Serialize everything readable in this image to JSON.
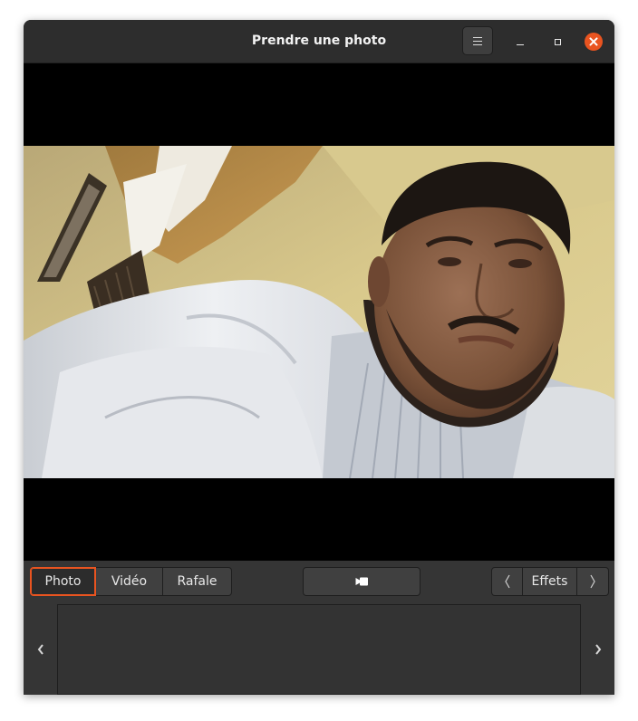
{
  "window": {
    "title": "Prendre une photo"
  },
  "header": {
    "menu_icon": "hamburger-menu-icon",
    "controls": [
      "minimize-icon",
      "maximize-icon",
      "close-icon"
    ]
  },
  "viewport": {
    "content": "camera-feed-image"
  },
  "modes": {
    "photo": "Photo",
    "video": "Vidéo",
    "burst": "Rafale",
    "active": "Photo"
  },
  "shutter": {
    "icon": "video-camera-icon"
  },
  "effects": {
    "label": "Effets",
    "prev_icon": "chevron-left-icon",
    "next_icon": "chevron-right-icon"
  },
  "gallery": {
    "prev_icon": "chevron-left-icon",
    "next_icon": "chevron-right-icon"
  },
  "colors": {
    "accent": "#e95420",
    "window_bg": "#353535",
    "headerbar_bg": "#2d2d2d",
    "button_bg": "#404040",
    "viewport_bg": "#000000"
  }
}
